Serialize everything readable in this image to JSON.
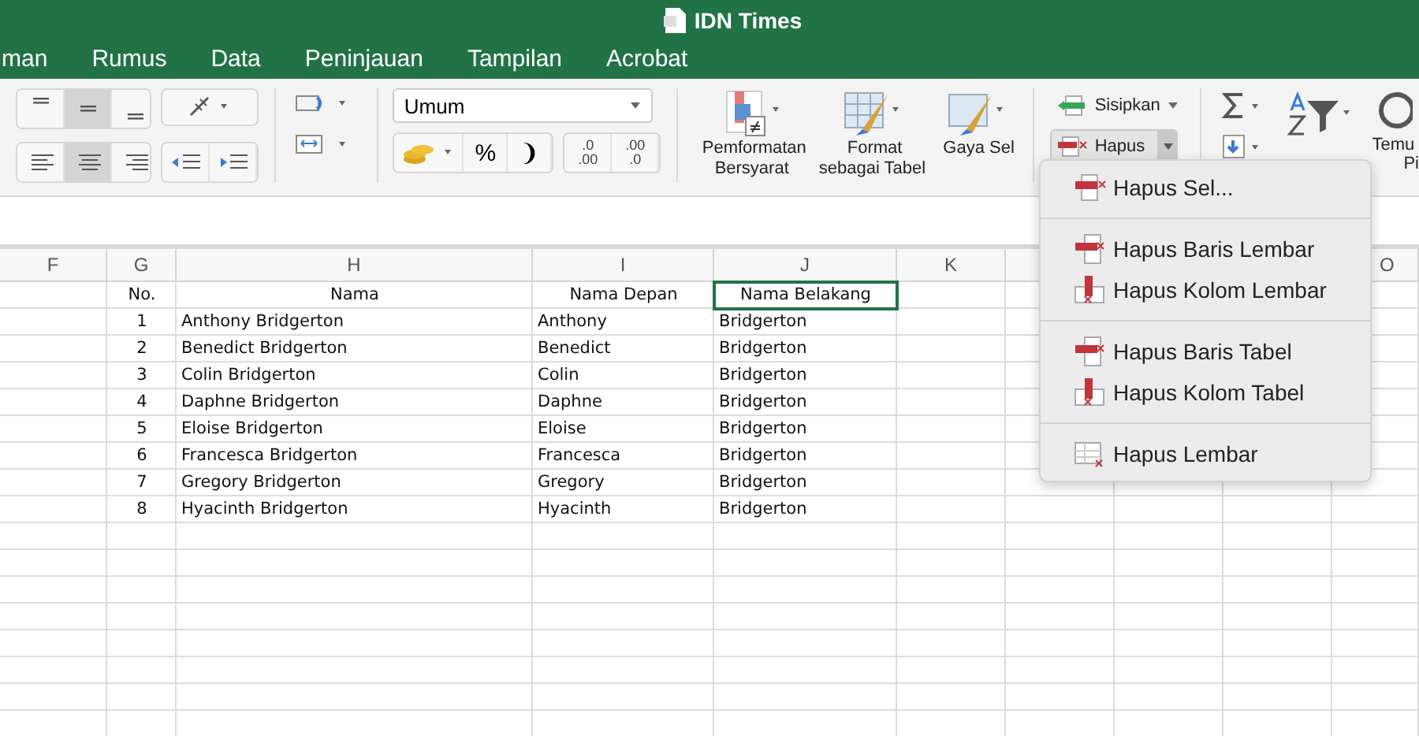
{
  "window": {
    "title": "IDN Times"
  },
  "tabs": [
    {
      "label": "man",
      "selected": false
    },
    {
      "label": "Rumus",
      "selected": false
    },
    {
      "label": "Data",
      "selected": false
    },
    {
      "label": "Peninjauan",
      "selected": false
    },
    {
      "label": "Tampilan",
      "selected": false
    },
    {
      "label": "Acrobat",
      "selected": false
    }
  ],
  "ribbon": {
    "vertical_align": [
      {
        "kind": "top",
        "selected": false
      },
      {
        "kind": "middle",
        "selected": true
      },
      {
        "kind": "bottom",
        "selected": false
      }
    ],
    "horizontal_align": [
      {
        "kind": "left",
        "selected": false
      },
      {
        "kind": "center",
        "selected": true
      },
      {
        "kind": "right",
        "selected": false
      }
    ],
    "number_format": {
      "value": "Umum"
    },
    "number_buttons": [
      {
        "kind": "currency"
      },
      {
        "kind": "text",
        "label": "%"
      },
      {
        "kind": "text",
        "label": "❩"
      }
    ],
    "decimal_buttons": [
      {
        "top": ".0",
        "bottom": ".00"
      },
      {
        "top": ".00",
        "bottom": ".0"
      }
    ],
    "style_buttons": [
      {
        "kind": "conditional",
        "label": "Pemformatan\nBersyarat"
      },
      {
        "kind": "table",
        "label": "Format\nsebagai Tabel"
      },
      {
        "kind": "cell",
        "label": "Gaya Sel"
      }
    ],
    "cells_buttons": [
      {
        "kind": "insert",
        "label": "Sisipkan",
        "pressed": false
      },
      {
        "kind": "delete",
        "label": "Hapus",
        "pressed": true
      }
    ],
    "cut_labels": [
      "Temu",
      "Pi"
    ]
  },
  "sheet": {
    "columns": [
      {
        "letter": "F"
      },
      {
        "letter": "G"
      },
      {
        "letter": "H"
      },
      {
        "letter": "I"
      },
      {
        "letter": "J"
      },
      {
        "letter": "K"
      },
      {
        "letter": "O"
      }
    ],
    "header": [
      {
        "selected": false
      },
      {
        "text": "No.",
        "selected": false
      },
      {
        "text": "Nama",
        "selected": false
      },
      {
        "text": "Nama Depan",
        "selected": false
      },
      {
        "text": "Nama Belakang",
        "selected": true
      }
    ],
    "rows": [
      [
        null,
        "1",
        "Anthony Bridgerton",
        "Anthony",
        "Bridgerton"
      ],
      [
        null,
        "2",
        "Benedict Bridgerton",
        "Benedict",
        "Bridgerton"
      ],
      [
        null,
        "3",
        "Colin Bridgerton",
        "Colin",
        "Bridgerton"
      ],
      [
        null,
        "4",
        "Daphne Bridgerton",
        "Daphne",
        "Bridgerton"
      ],
      [
        null,
        "5",
        "Eloise Bridgerton",
        "Eloise",
        "Bridgerton"
      ],
      [
        null,
        "6",
        "Francesca Bridgerton",
        "Francesca",
        "Bridgerton"
      ],
      [
        null,
        "7",
        "Gregory Bridgerton",
        "Gregory",
        "Bridgerton"
      ],
      [
        null,
        "8",
        "Hyacinth Bridgerton",
        "Hyacinth",
        "Bridgerton"
      ]
    ]
  },
  "menu": {
    "groups": [
      [
        {
          "label": "Hapus Sel...",
          "kind": "cells"
        }
      ],
      [
        {
          "label": "Hapus Baris Lembar",
          "kind": "row"
        },
        {
          "label": "Hapus Kolom Lembar",
          "kind": "column"
        }
      ],
      [
        {
          "label": "Hapus Baris Tabel",
          "kind": "row"
        },
        {
          "label": "Hapus Kolom Tabel",
          "kind": "column"
        }
      ],
      [
        {
          "label": "Hapus Lembar",
          "kind": "sheet"
        }
      ]
    ]
  }
}
